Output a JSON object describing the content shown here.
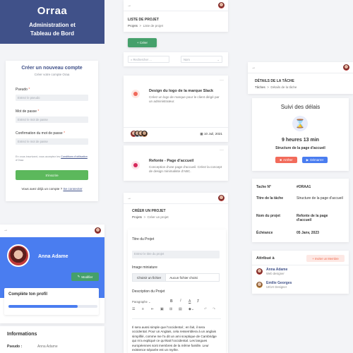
{
  "brand": {
    "logo": "Orraa",
    "title_line1": "Administration et",
    "title_line2": "Tableau de Bord"
  },
  "signup": {
    "title": "Créer un nouveau compte",
    "subtitle": "Créer votre compte Oraa",
    "pseudo_label": "Pseudo",
    "pseudo_placeholder": "Entrez le pseudo",
    "password_label": "Mot de passe",
    "password_placeholder": "Entrez le mot de passe",
    "confirm_label": "Confirmation du mot de passe",
    "confirm_placeholder": "Entrez le mot de passe",
    "terms_text": "En vous inscrivant, vous acceptez les",
    "terms_link": "Conditions d'utilisation",
    "terms_suffix": "d'Oraa",
    "submit": "S'inscrire",
    "have_account": "Vous avez déjà un compte ?",
    "login_link": "Se connecter"
  },
  "profile": {
    "name": "Anna Adame",
    "edit_button": "Modifier",
    "complete_title": "Complète ton profil",
    "complete_progress": 0.78,
    "info_title": "Informations",
    "pseudo_label": "Pseudo :",
    "pseudo_value": "Anna Adame"
  },
  "project_list": {
    "breadcrumb_title": "LISTE DE PROJET",
    "crumb_root": "Projets",
    "crumb_current": "Liste de projet",
    "create_button": "+ Créer",
    "search_placeholder": "Rechercher ...",
    "sort_placeholder": "Nom",
    "projects": [
      {
        "title": "Design du logo de la marque Slack",
        "desc": "Créez un logo de marque pour le client dirigé par un administrateur.",
        "date": "10 Juil, 2021",
        "dot": "#f0695a"
      },
      {
        "title": "Refonte - Page d'accueil",
        "desc": "Conception d'une page d'accueil. Créez la concept de design minimaliste d'ABC.",
        "dot": "#d6285b"
      }
    ]
  },
  "task_detail": {
    "breadcrumb_title": "DÉTAILS DE LA TÂCHE",
    "crumb_root": "Tâches",
    "crumb_current": "Détails de la tâche",
    "timer_title": "Suivi des délais",
    "duration": "9 heures 13 min",
    "structure": "Structure de la page d'accueil",
    "stop_button": "Arrêter",
    "start_button": "Démarrer",
    "info_rows": [
      {
        "label": "Tache N°",
        "value": "#ORAA1"
      },
      {
        "label": "Titre de la tâche",
        "value": "Structure de la page d'accueil"
      },
      {
        "label": "Nom du projet",
        "value": "Refonte de la page d'accueil"
      },
      {
        "label": "Échéance",
        "value": "05 Janv, 2023"
      }
    ],
    "assigned_title": "Attribué à",
    "invite_button": "+ Inviter un Membre",
    "members": [
      {
        "name": "Anna Adame",
        "role": "Web designer"
      },
      {
        "name": "Emilie Georges",
        "role": "UI/UX Designer"
      }
    ]
  },
  "create_project": {
    "breadcrumb_title": "CRÉER UN PROJET",
    "crumb_root": "Projets",
    "crumb_current": "Créer un projet",
    "title_label": "Titre du Projet",
    "title_placeholder": "Entrez le titre du projet",
    "thumb_label": "Image miniature",
    "choose_file": "Choisir un fichier",
    "no_file": "Aucun fichier choisi",
    "desc_label": "Description du Projet",
    "paragraph_select": "Paragraphe",
    "editor_text": "Il sera aussi simple que l'occidental ; en fait, il sera occidental. Pour un Anglais, cela ressemblera à un anglais simplifié, comme me l'a dit un ami sceptique de Cambridge qui m'a expliqué ce qu'était l'occidental. Les langues européennes sont membres de la même famille. Leur existence séparée est un mythe."
  }
}
